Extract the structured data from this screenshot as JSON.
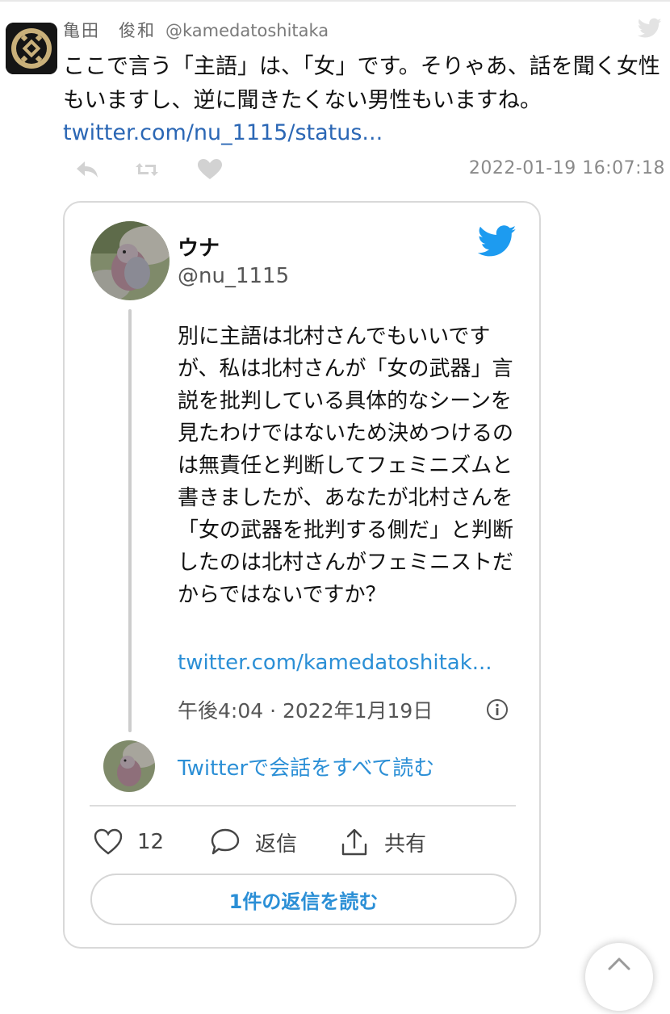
{
  "tweet": {
    "author_name": "亀田　俊和",
    "author_handle": "@kamedatoshitaka",
    "text": "ここで言う「主語」は、「女」です。そりゃあ、話を聞く女性もいますし、逆に聞きたくない男性もいますね。",
    "link": "twitter.com/nu_1115/status...",
    "timestamp": "2022-01-19 16:07:18",
    "avatar_icon": "family-crest-icon"
  },
  "embed": {
    "name": "ウナ",
    "handle": "@nu_1115",
    "body": "別に主語は北村さんでもいいですが、私は北村さんが「女の武器」言説を批判している具体的なシーンを見たわけではないため決めつけるのは無責任と判断してフェミニズムと書きましたが、あなたが北村さんを「女の武器を批判する側だ」と判断したのは北村さんがフェミニストだからではないですか？",
    "link": "twitter.com/kamedatoshitak...",
    "meta": "午後4:04 · 2022年1月19日",
    "conversation_link": "Twitterで会話をすべて読む",
    "like_count": "12",
    "reply_label": "返信",
    "share_label": "共有",
    "read_replies_button": "1件の返信を読む",
    "avatar_icon": "pigeon-photo-icon"
  },
  "colors": {
    "link_dark": "#2b67b5",
    "link_blue": "#2b8fd6",
    "twitter_blue": "#1d9bf0",
    "muted_icon": "#d0d0d0"
  }
}
